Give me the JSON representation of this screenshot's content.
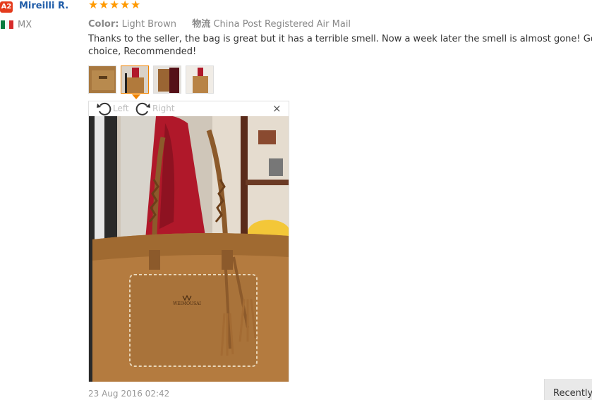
{
  "reviewer": {
    "level_badge": "A2",
    "name": "Mireilli R.",
    "country": "MX"
  },
  "review": {
    "rating": 5,
    "stars": [
      "★",
      "★",
      "★",
      "★",
      "★"
    ],
    "color_label": "Color:",
    "color_value": "Light Brown",
    "shipping_label": "物流",
    "shipping_value": "China Post Registered Air Mail",
    "text": "Thanks to the seller, the bag is great but it has a terrible smell. Now a week later the smell is almost gone! Good choice, Recommended!",
    "date": "23 Aug 2016 02:42",
    "thumbnail_count": 4,
    "selected_thumbnail": 2
  },
  "viewer": {
    "rotate_left_label": "Left",
    "rotate_right_label": "Right",
    "close_label": "×",
    "watermark": "WEIMOUSAI"
  },
  "side": {
    "recently_label": "Recently"
  },
  "colors": {
    "accent": "#f08300",
    "name_link": "#1f5ca8",
    "badge": "#e43b1c",
    "star": "#ff9a00"
  }
}
